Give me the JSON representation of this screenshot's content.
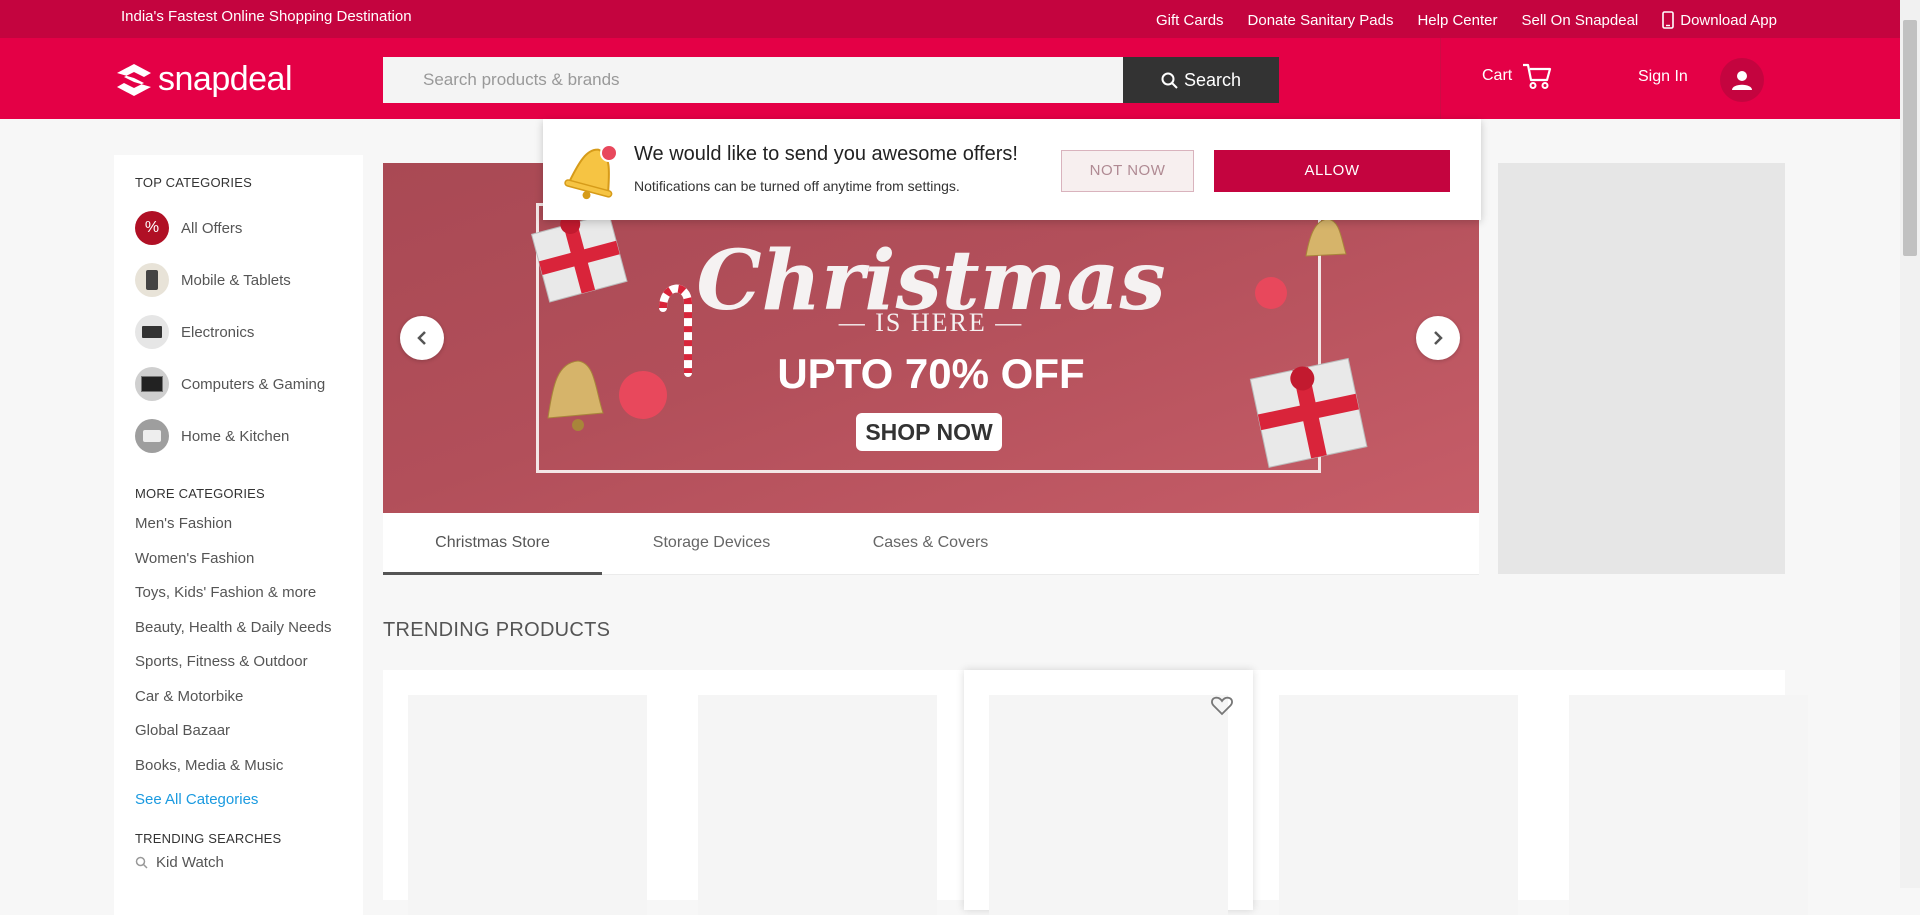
{
  "topbar": {
    "tagline": "India's Fastest Online Shopping Destination",
    "links": [
      "Gift Cards",
      "Donate Sanitary Pads",
      "Help Center",
      "Sell On Snapdeal",
      "Download App"
    ]
  },
  "header": {
    "logo": "snapdeal",
    "search_placeholder": "Search products & brands",
    "search_button": "Search",
    "cart_label": "Cart",
    "signin_label": "Sign In"
  },
  "sidebar": {
    "top_title": "TOP CATEGORIES",
    "top_categories": [
      "All Offers",
      "Mobile & Tablets",
      "Electronics",
      "Computers & Gaming",
      "Home & Kitchen"
    ],
    "more_title": "MORE CATEGORIES",
    "more_categories": [
      "Men's Fashion",
      "Women's Fashion",
      "Toys, Kids' Fashion & more",
      "Beauty, Health & Daily Needs",
      "Sports, Fitness & Outdoor",
      "Car & Motorbike",
      "Global Bazaar",
      "Books, Media & Music"
    ],
    "see_all": "See All Categories",
    "trending_title": "TRENDING SEARCHES",
    "trending_searches": [
      "Kid Watch"
    ]
  },
  "banner": {
    "title": "Christmas",
    "subtitle": "— IS HERE —",
    "offer": "UPTO 70% OFF",
    "cta": "SHOP NOW"
  },
  "tabs": [
    "Christmas Store",
    "Storage Devices",
    "Cases & Covers"
  ],
  "trending_products_title": "TRENDING PRODUCTS",
  "notification": {
    "title": "We would like to send you awesome offers!",
    "text": "Notifications can be turned off anytime from settings.",
    "not_now": "NOT NOW",
    "allow": "ALLOW"
  },
  "colors": {
    "brand": "#e40046",
    "brand_dark": "#c4043f",
    "link": "#1a9ae0"
  }
}
